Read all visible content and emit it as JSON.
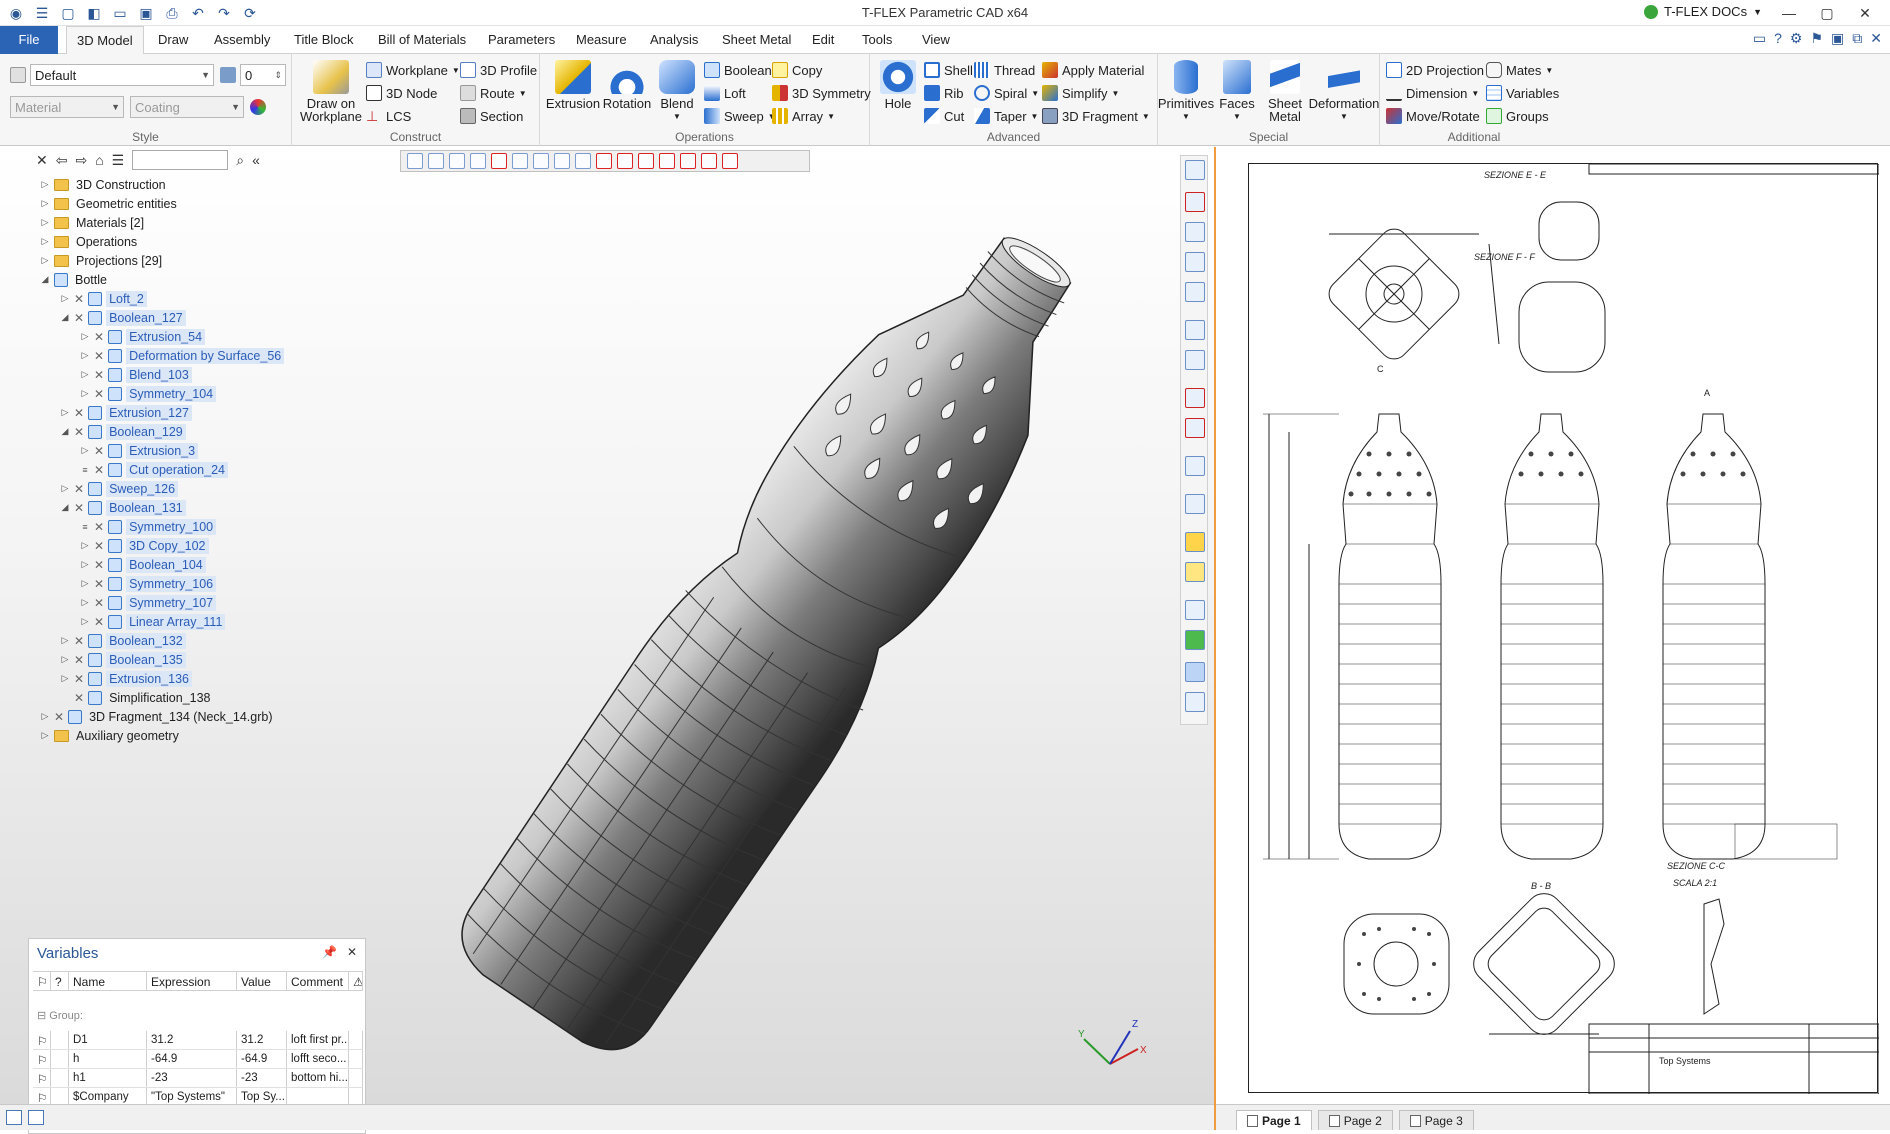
{
  "app": {
    "title": "T-FLEX Parametric CAD x64",
    "docs_label": "T-FLEX DOCs"
  },
  "tabs": [
    "File",
    "3D Model",
    "Draw",
    "Assembly",
    "Title Block",
    "Bill of Materials",
    "Parameters",
    "Measure",
    "Analysis",
    "Sheet Metal",
    "Edit",
    "Tools",
    "View"
  ],
  "ribbon": {
    "style": {
      "caption": "Style",
      "style_value": "Default",
      "layer_value": "0",
      "material_placeholder": "Material",
      "coating_placeholder": "Coating"
    },
    "construct": {
      "caption": "Construct",
      "draw_on": "Draw on",
      "workplane_big": "Workplane",
      "workplane": "Workplane",
      "node": "3D Node",
      "lcs": "LCS",
      "profile": "3D Profile",
      "route": "Route",
      "section": "Section"
    },
    "operations": {
      "caption": "Operations",
      "extrusion": "Extrusion",
      "rotation": "Rotation",
      "blend": "Blend",
      "boolean": "Boolean",
      "loft": "Loft",
      "sweep": "Sweep",
      "copy": "Copy",
      "symmetry": "3D Symmetry",
      "array": "Array"
    },
    "advanced": {
      "caption": "Advanced",
      "hole": "Hole",
      "shell": "Shell",
      "rib": "Rib",
      "cut": "Cut",
      "thread": "Thread",
      "spiral": "Spiral",
      "taper": "Taper",
      "apply_material": "Apply Material",
      "simplify": "Simplify",
      "fragment": "3D Fragment"
    },
    "special": {
      "caption": "Special",
      "primitives": "Primitives",
      "faces": "Faces",
      "sheet": "Sheet",
      "metal": "Metal",
      "deformation": "Deformation"
    },
    "additional": {
      "caption": "Additional",
      "projection": "2D Projection",
      "dimension": "Dimension",
      "move": "Move/Rotate",
      "mates": "Mates",
      "variables": "Variables",
      "groups": "Groups"
    }
  },
  "tree": [
    {
      "label": "3D Construction",
      "type": "folder",
      "indent": 0,
      "exp": "▷"
    },
    {
      "label": "Geometric entities",
      "type": "folder",
      "indent": 0,
      "exp": "▷"
    },
    {
      "label": "Materials [2]",
      "type": "folder",
      "indent": 0,
      "exp": "▷"
    },
    {
      "label": "Operations",
      "type": "folder",
      "indent": 0,
      "exp": "▷"
    },
    {
      "label": "Projections [29]",
      "type": "folder",
      "indent": 0,
      "exp": "▷"
    },
    {
      "label": "Bottle",
      "type": "body",
      "indent": 0,
      "exp": "◢"
    },
    {
      "label": "Loft_2",
      "type": "op",
      "indent": 1,
      "exp": "▷"
    },
    {
      "label": "Boolean_127",
      "type": "op",
      "indent": 1,
      "exp": "◢"
    },
    {
      "label": "Extrusion_54",
      "type": "op",
      "indent": 2,
      "exp": "▷"
    },
    {
      "label": "Deformation by Surface_56",
      "type": "op",
      "indent": 2,
      "exp": "▷"
    },
    {
      "label": "Blend_103",
      "type": "op",
      "indent": 2,
      "exp": "▷"
    },
    {
      "label": "Symmetry_104",
      "type": "op",
      "indent": 2,
      "exp": "▷"
    },
    {
      "label": "Extrusion_127",
      "type": "op",
      "indent": 1,
      "exp": "▷"
    },
    {
      "label": "Boolean_129",
      "type": "op",
      "indent": 1,
      "exp": "◢"
    },
    {
      "label": "Extrusion_3",
      "type": "op",
      "indent": 2,
      "exp": "▷"
    },
    {
      "label": "Cut operation_24",
      "type": "op",
      "indent": 2,
      "exp": "≡"
    },
    {
      "label": "Sweep_126",
      "type": "op",
      "indent": 1,
      "exp": "▷"
    },
    {
      "label": "Boolean_131",
      "type": "op",
      "indent": 1,
      "exp": "◢"
    },
    {
      "label": "Symmetry_100",
      "type": "op",
      "indent": 2,
      "exp": "≡"
    },
    {
      "label": "3D Copy_102",
      "type": "op",
      "indent": 2,
      "exp": "▷"
    },
    {
      "label": "Boolean_104",
      "type": "op",
      "indent": 2,
      "exp": "▷"
    },
    {
      "label": "Symmetry_106",
      "type": "op",
      "indent": 2,
      "exp": "▷"
    },
    {
      "label": "Symmetry_107",
      "type": "op",
      "indent": 2,
      "exp": "▷"
    },
    {
      "label": "Linear Array_111",
      "type": "op",
      "indent": 2,
      "exp": "▷"
    },
    {
      "label": "Boolean_132",
      "type": "op",
      "indent": 1,
      "exp": "▷"
    },
    {
      "label": "Boolean_135",
      "type": "op",
      "indent": 1,
      "exp": "▷"
    },
    {
      "label": "Extrusion_136",
      "type": "op",
      "indent": 1,
      "exp": "▷"
    },
    {
      "label": "Simplification_138",
      "type": "plain",
      "indent": 1,
      "exp": ""
    },
    {
      "label": "3D Fragment_134 (Neck_14.grb)",
      "type": "plain",
      "indent": 0,
      "exp": "▷"
    },
    {
      "label": "Auxiliary geometry",
      "type": "folder",
      "indent": 0,
      "exp": "▷"
    }
  ],
  "variables": {
    "title": "Variables",
    "headers": [
      "?",
      "Name",
      "Expression",
      "Value",
      "Comment"
    ],
    "group_label": "Group:",
    "rows": [
      {
        "name": "D1",
        "expr": "31.2",
        "value": "31.2",
        "comment": "loft first pr..."
      },
      {
        "name": "h",
        "expr": "-64.9",
        "value": "-64.9",
        "comment": "lofft seco..."
      },
      {
        "name": "h1",
        "expr": "-23",
        "value": "-23",
        "comment": "bottom hi..."
      },
      {
        "name": "$Company",
        "expr": "\"Top Systems\"",
        "value": "Top Sy...",
        "comment": ""
      }
    ]
  },
  "viewport": {
    "axis_x": "X",
    "axis_y": "Y",
    "axis_z": "Z"
  },
  "drawing": {
    "section_ee": "SEZIONE E - E",
    "section_ff": "SEZIONE F - F",
    "section_cc": "SEZIONE C-C",
    "scale": "SCALA 2:1",
    "label_a": "A",
    "label_c": "C",
    "label_bb": "B - B",
    "company": "Top Systems"
  },
  "pages": [
    "Page 1",
    "Page 2",
    "Page 3"
  ]
}
